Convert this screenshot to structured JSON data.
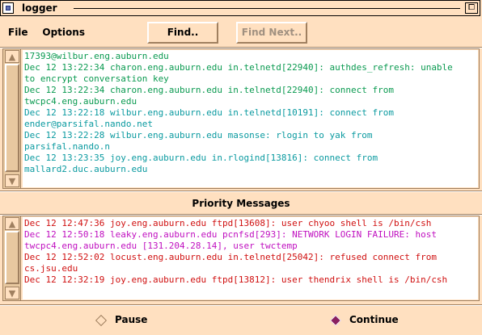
{
  "window": {
    "title": "logger",
    "resize_glyph": "⧠"
  },
  "menu": {
    "file_label": "File",
    "options_label": "Options"
  },
  "toolbar": {
    "find_label": "Find..",
    "find_next_label": "Find Next.."
  },
  "main_log": {
    "lines": [
      {
        "text": "17393@wilbur.eng.auburn.edu",
        "color": "#0a9a50"
      },
      {
        "text": "Dec 12 13:22:34 charon.eng.auburn.edu in.telnetd[22940]: authdes_refresh: unable",
        "color": "#0a9a50"
      },
      {
        "text": "to encrypt conversation key",
        "color": "#0a9a50"
      },
      {
        "text": "Dec 12 13:22:34 charon.eng.auburn.edu in.telnetd[22940]: connect from",
        "color": "#0a9a50"
      },
      {
        "text": "twcpc4.eng.auburn.edu",
        "color": "#0a9a50"
      },
      {
        "text": "Dec 12 13:22:18 wilbur.eng.auburn.edu in.telnetd[10191]: connect from",
        "color": "#0a9aa0"
      },
      {
        "text": "ender@parsifal.nando.net",
        "color": "#0a9aa0"
      },
      {
        "text": "Dec 12 13:22:28 wilbur.eng.auburn.edu masonse: rlogin to yak from",
        "color": "#0a9aa0"
      },
      {
        "text": "parsifal.nando.n",
        "color": "#0a9aa0"
      },
      {
        "text": "Dec 12 13:23:35 joy.eng.auburn.edu in.rlogind[13816]: connect from",
        "color": "#0a9aa0"
      },
      {
        "text": "mallard2.duc.auburn.edu",
        "color": "#0a9aa0"
      }
    ]
  },
  "priority": {
    "title": "Priority Messages",
    "lines": [
      {
        "text": "Dec 12 12:47:36 joy.eng.auburn.edu ftpd[13608]: user chyoo shell is /bin/csh",
        "color": "#d01010"
      },
      {
        "text": "Dec 12 12:50:18 leaky.eng.auburn.edu pcnfsd[293]: NETWORK LOGIN FAILURE: host",
        "color": "#c010c0"
      },
      {
        "text": "twcpc4.eng.auburn.edu [131.204.28.14], user twctemp",
        "color": "#c010c0"
      },
      {
        "text": "Dec 12 12:52:02 locust.eng.auburn.edu in.telnetd[25042]: refused connect from",
        "color": "#d01010"
      },
      {
        "text": "cs.jsu.edu",
        "color": "#d01010"
      },
      {
        "text": "Dec 12 12:32:19 joy.eng.auburn.edu ftpd[13812]: user thendrix shell is /bin/csh",
        "color": "#d01010"
      }
    ]
  },
  "controls": {
    "pause_label": "Pause",
    "continue_label": "Continue",
    "selected": "continue"
  },
  "icons": {
    "window_menu": "window-menu-icon",
    "resize": "resize-icon",
    "scroll_up": "arrow-up-icon",
    "scroll_down": "arrow-down-icon",
    "radio": "diamond-radio-icon"
  },
  "colors": {
    "background": "#ffe0c0",
    "text_area": "#ffffff",
    "selected_radio": "#8a2060"
  }
}
